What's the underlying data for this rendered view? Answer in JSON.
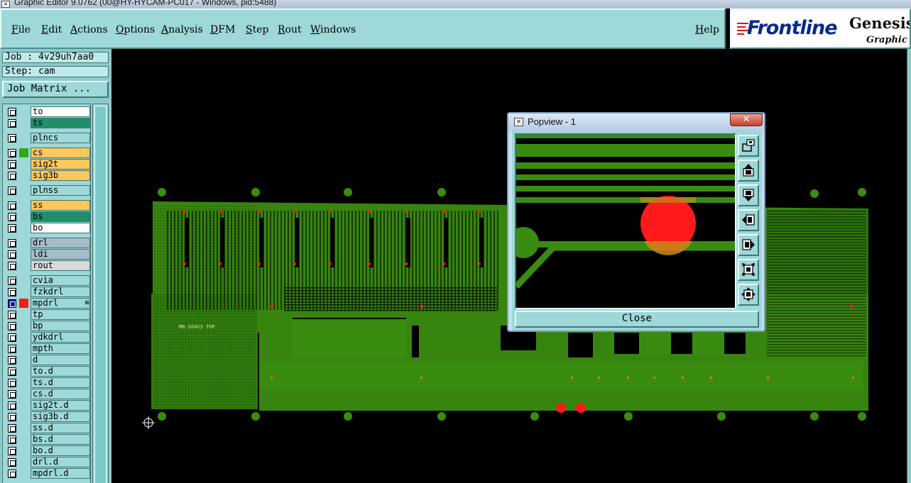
{
  "window": {
    "title": "Graphic Editor 9.0762 (00@HY-HYCAM-PC017 - Windows, pid:5488)"
  },
  "menu": {
    "file": "File",
    "edit": "Edit",
    "actions": "Actions",
    "options": "Options",
    "analysis": "Analysis",
    "dfm": "DFM",
    "step": "Step",
    "rout": "Rout",
    "windows": "Windows",
    "help": "Help"
  },
  "logo": {
    "brand": "Frontline",
    "product": "Genesis",
    "subtitle": "Graphic Ed"
  },
  "job": {
    "job_label": "Job : 4v29uh7aa0",
    "step_label": "Step: cam",
    "matrix_button": "Job Matrix ..."
  },
  "layers": [
    {
      "name": "to",
      "color": "#ffffff"
    },
    {
      "name": "ts",
      "color": "#1f8f6a"
    },
    {
      "name": "plncs",
      "color": "#9ed8d8"
    },
    {
      "name": "cs",
      "color": "#ffc85a",
      "swatch": "#36a61a"
    },
    {
      "name": "sig2t",
      "color": "#ffc85a"
    },
    {
      "name": "sig3b",
      "color": "#ffc85a"
    },
    {
      "name": "plnss",
      "color": "#9ed8d8"
    },
    {
      "name": "ss",
      "color": "#ffc85a"
    },
    {
      "name": "bs",
      "color": "#1f8f6a"
    },
    {
      "name": "bo",
      "color": "#ffffff"
    },
    {
      "name": "drl",
      "color": "#a8bcc8"
    },
    {
      "name": "ldi",
      "color": "#a8bcc8"
    },
    {
      "name": "rout",
      "color": "#d8d8d8"
    },
    {
      "name": "cvia",
      "color": "#9ed8d8"
    },
    {
      "name": "fzkdrl",
      "color": "#9ed8d8"
    },
    {
      "name": "mpdrl",
      "color": "#9ed8d8",
      "swatch": "#ff1a1a",
      "selected": true
    },
    {
      "name": "tp",
      "color": "#9ed8d8"
    },
    {
      "name": "bp",
      "color": "#9ed8d8"
    },
    {
      "name": "ydkdrl",
      "color": "#9ed8d8"
    },
    {
      "name": "mpth",
      "color": "#9ed8d8"
    },
    {
      "name": "d",
      "color": "#9ed8d8"
    },
    {
      "name": "to.d",
      "color": "#9ed8d8"
    },
    {
      "name": "ts.d",
      "color": "#9ed8d8"
    },
    {
      "name": "cs.d",
      "color": "#9ed8d8"
    },
    {
      "name": "sig2t.d",
      "color": "#9ed8d8"
    },
    {
      "name": "sig3b.d",
      "color": "#9ed8d8"
    },
    {
      "name": "ss.d",
      "color": "#9ed8d8"
    },
    {
      "name": "bs.d",
      "color": "#9ed8d8"
    },
    {
      "name": "bo.d",
      "color": "#9ed8d8"
    },
    {
      "name": "drl.d",
      "color": "#9ed8d8"
    },
    {
      "name": "mpdrl.d",
      "color": "#9ed8d8"
    }
  ],
  "canvas": {
    "board_label": "M6-S04V3 TOP",
    "copper_color": "#3a8c10",
    "drill_color": "#ff1a1a"
  },
  "popview": {
    "title": "Popview - 1",
    "close_label": "Close"
  }
}
